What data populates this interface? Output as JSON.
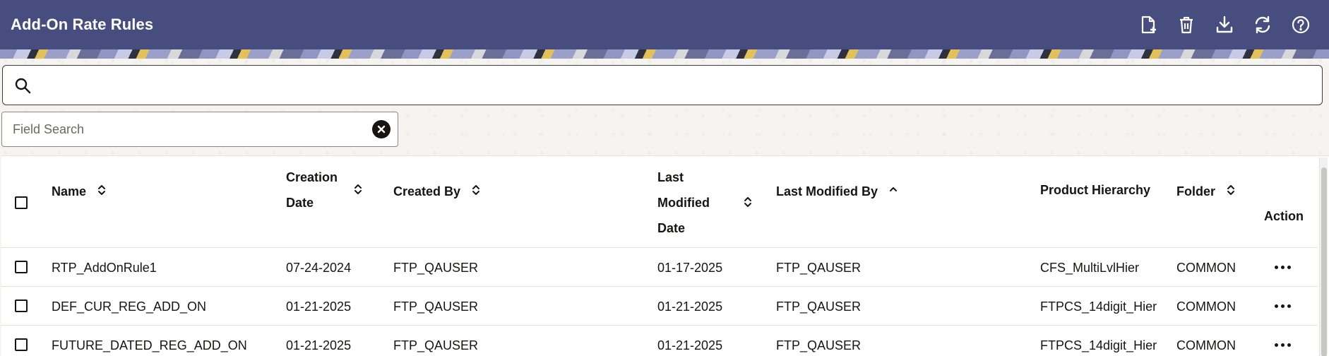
{
  "header": {
    "title": "Add-On Rate Rules",
    "toolbar": [
      {
        "name": "add-icon"
      },
      {
        "name": "delete-icon"
      },
      {
        "name": "download-icon"
      },
      {
        "name": "refresh-icon"
      },
      {
        "name": "help-icon"
      }
    ]
  },
  "search": {
    "value": "",
    "placeholder": ""
  },
  "field_search": {
    "value": "",
    "placeholder": "Field Search"
  },
  "table": {
    "columns": {
      "name": "Name",
      "creation_date_1": "Creation",
      "creation_date_2": "Date",
      "created_by": "Created By",
      "last_modified_1": "Last",
      "last_modified_2": "Modified",
      "last_modified_3": "Date",
      "last_modified_by": "Last Modified By",
      "product_hierarchy": "Product Hierarchy",
      "folder": "Folder",
      "action": "Action"
    },
    "rows": [
      {
        "name": "RTP_AddOnRule1",
        "creation_date": "07-24-2024",
        "created_by": "FTP_QAUSER",
        "last_modified_date": "01-17-2025",
        "last_modified_by": "FTP_QAUSER",
        "product_hierarchy": "CFS_MultiLvlHier",
        "folder": "COMMON"
      },
      {
        "name": "DEF_CUR_REG_ADD_ON",
        "creation_date": "01-21-2025",
        "created_by": "FTP_QAUSER",
        "last_modified_date": "01-21-2025",
        "last_modified_by": "FTP_QAUSER",
        "product_hierarchy": "FTPCS_14digit_Hier",
        "folder": "COMMON"
      },
      {
        "name": "FUTURE_DATED_REG_ADD_ON",
        "creation_date": "01-21-2025",
        "created_by": "FTP_QAUSER",
        "last_modified_date": "01-21-2025",
        "last_modified_by": "FTP_QAUSER",
        "product_hierarchy": "FTPCS_14digit_Hier",
        "folder": "COMMON"
      }
    ]
  },
  "colors": {
    "header_bg": "#474d7f",
    "header_text": "#ffffff"
  }
}
